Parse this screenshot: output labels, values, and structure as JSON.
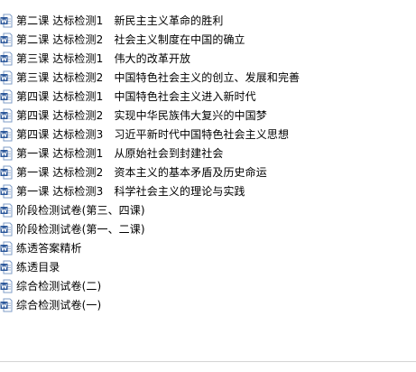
{
  "icon": "word-document-icon",
  "colors": {
    "icon_blue": "#2b579a",
    "icon_page": "#ffffff",
    "text": "#000000",
    "background": "#ffffff"
  },
  "files": [
    {
      "name": "第二课 达标检测1　新民主主义革命的胜利"
    },
    {
      "name": "第二课 达标检测2　社会主义制度在中国的确立"
    },
    {
      "name": "第三课 达标检测1　伟大的改革开放"
    },
    {
      "name": "第三课 达标检测2　中国特色社会主义的创立、发展和完善"
    },
    {
      "name": "第四课 达标检测1　中国特色社会主义进入新时代"
    },
    {
      "name": "第四课 达标检测2　实现中华民族伟大复兴的中国梦"
    },
    {
      "name": "第四课 达标检测3　习近平新时代中国特色社会主义思想"
    },
    {
      "name": "第一课 达标检测1　从原始社会到封建社会"
    },
    {
      "name": "第一课 达标检测2　资本主义的基本矛盾及历史命运"
    },
    {
      "name": "第一课 达标检测3　科学社会主义的理论与实践"
    },
    {
      "name": "阶段检测试卷(第三、四课)"
    },
    {
      "name": "阶段检测试卷(第一、二课)"
    },
    {
      "name": "练透答案精析"
    },
    {
      "name": "练透目录"
    },
    {
      "name": "综合检测试卷(二)"
    },
    {
      "name": "综合检测试卷(一)"
    }
  ]
}
